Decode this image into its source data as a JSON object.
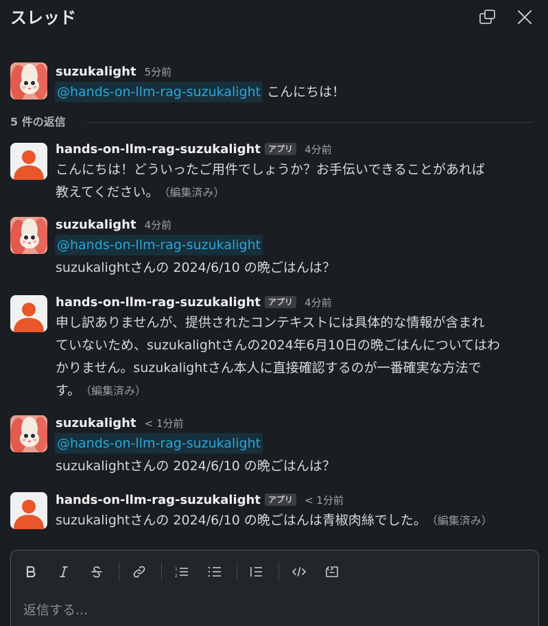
{
  "header": {
    "title": "スレッド",
    "icons": [
      "popout-icon",
      "close-icon"
    ]
  },
  "root": {
    "user": "suzukalight",
    "time": "5分前",
    "mention": "@hands-on-llm-rag-suzukalight",
    "text": "こんにちは！"
  },
  "replies_label": "5 件の返信",
  "messages": [
    {
      "user": "hands-on-llm-rag-suzukalight",
      "badge": "アプリ",
      "time": "4分前",
      "lines": [
        "こんにちは！どういったご用件でしょうか？お手伝いできることがあれば",
        "教えてください。"
      ],
      "edited": "（編集済み）"
    },
    {
      "user": "suzukalight",
      "time": "4分前",
      "mention": "@hands-on-llm-rag-suzukalight",
      "text": "suzukalightさんの 2024/6/10 の晩ごはんは？"
    },
    {
      "user": "hands-on-llm-rag-suzukalight",
      "badge": "アプリ",
      "time": "4分前",
      "lines": [
        "申し訳ありませんが、提供されたコンテキストには具体的な情報が含まれ",
        "ていないため、suzukalightさんの2024年6月10日の晩ごはんについてはわ",
        "かりません。suzukalightさん本人に直接確認するのが一番確実な方法で",
        "す。"
      ],
      "edited": "（編集済み）"
    },
    {
      "user": "suzukalight",
      "time": "< 1分前",
      "mention": "@hands-on-llm-rag-suzukalight",
      "text": "suzukalightさんの 2024/6/10 の晩ごはんは？"
    },
    {
      "user": "hands-on-llm-rag-suzukalight",
      "badge": "アプリ",
      "time": "< 1分前",
      "lines": [
        "suzukalightさんの 2024/6/10 の晩ごはんは青椒肉絲でした。"
      ],
      "edited": "（編集済み）"
    }
  ],
  "composer": {
    "placeholder": "返信する...",
    "toolbar": [
      "bold-icon",
      "italic-icon",
      "strikethrough-icon",
      "link-icon",
      "ordered-list-icon",
      "bulleted-list-icon",
      "blockquote-icon",
      "code-icon",
      "code-block-icon"
    ]
  },
  "colors": {
    "background": "#1a1d21",
    "mention": "#2ba7dc",
    "bot_avatar": "#e8562a"
  }
}
